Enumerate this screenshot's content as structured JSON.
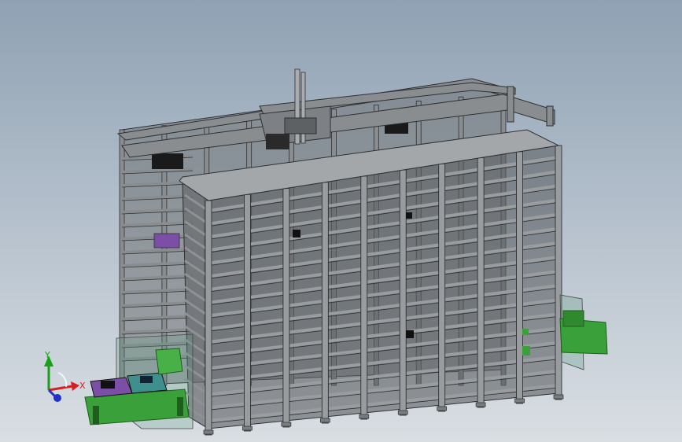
{
  "app": {
    "title": ""
  },
  "view": {
    "background_top": "#8fa1b3",
    "background_bottom": "#d9dee3",
    "model": {
      "frame_color": "#8a8d90",
      "frame_edge_color": "#2e3032",
      "rail_color": "#5f9e83",
      "conveyor_color": "#3aa13a",
      "tote_purple": "#7b4fa6",
      "tote_teal": "#3f8f8f",
      "front_columns": 9,
      "back_columns": 9,
      "levels": 17
    }
  },
  "triad": {
    "x_label": "X",
    "y_label": "Y",
    "x_color": "#d42020",
    "y_color": "#19a019",
    "z_color": "#2030c8"
  }
}
